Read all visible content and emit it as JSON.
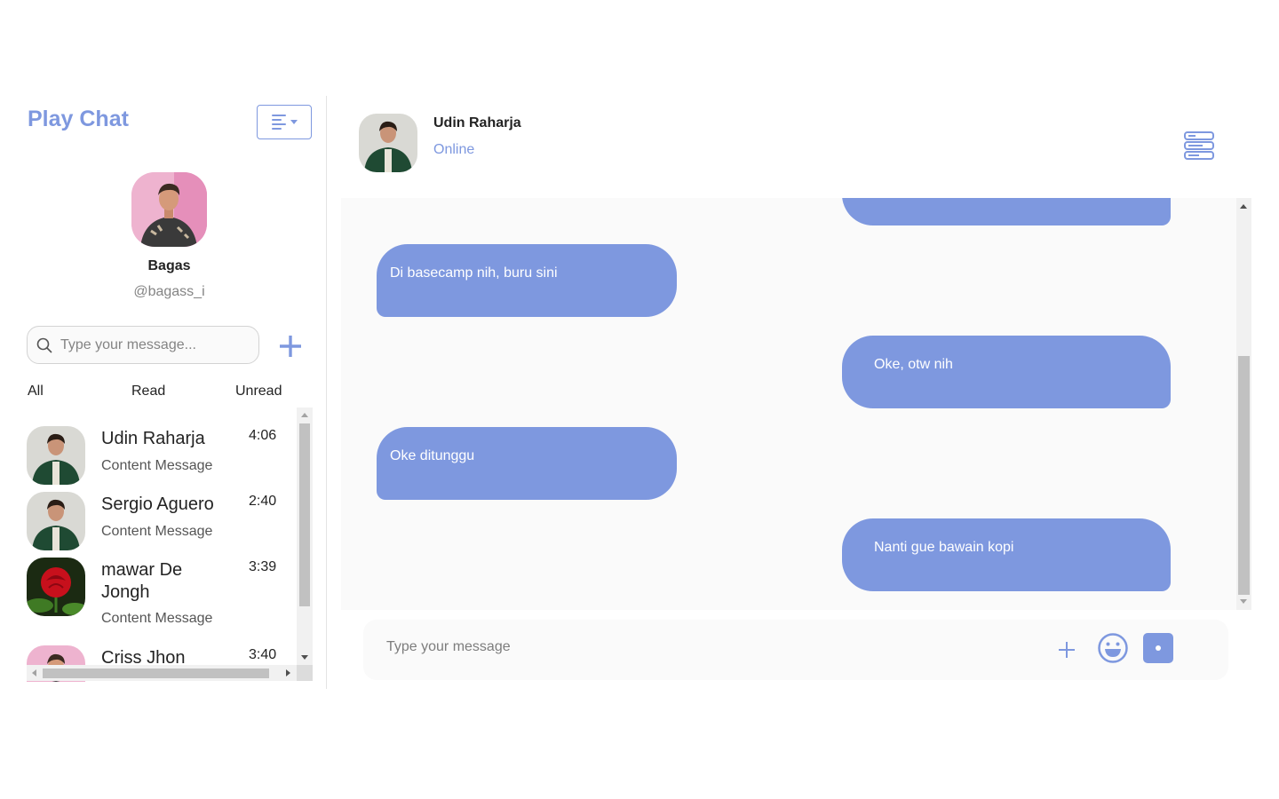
{
  "app": {
    "title": "Play Chat"
  },
  "colors": {
    "accent": "#7e98df",
    "bubble": "#7e98df",
    "panel_bg": "#fafafa"
  },
  "profile": {
    "name": "Bagas",
    "handle": "@bagass_i"
  },
  "search": {
    "placeholder": "Type your message..."
  },
  "filters": {
    "all": "All",
    "read": "Read",
    "unread": "Unread"
  },
  "chats": [
    {
      "name": "Udin Raharja",
      "time": "4:06",
      "message": "Content Message",
      "avatar": "person-green-jacket"
    },
    {
      "name": "Sergio Aguero",
      "time": "2:40",
      "message": "Content Message",
      "avatar": "person-green-jacket"
    },
    {
      "name": "mawar De Jongh",
      "time": "3:39",
      "message": "Content Message",
      "avatar": "red-rose"
    },
    {
      "name": "Criss Jhon",
      "time": "3:40",
      "message": "",
      "avatar": "person-pink-background"
    }
  ],
  "conversation": {
    "contact_name": "Udin Raharja",
    "status": "Online",
    "messages": [
      {
        "direction": "out",
        "text": ""
      },
      {
        "direction": "in",
        "text": "Di basecamp nih, buru sini"
      },
      {
        "direction": "out",
        "text": "Oke, otw nih"
      },
      {
        "direction": "in",
        "text": "Oke ditunggu"
      },
      {
        "direction": "out",
        "text": "Nanti gue bawain kopi"
      }
    ]
  },
  "composer": {
    "placeholder": "Type your message"
  },
  "icons": {
    "menu": "menu-lines-icon",
    "add_chat": "plus-icon",
    "search": "search-icon",
    "header_menu": "stacked-menu-icon",
    "attach": "plus-icon",
    "emoji": "emoji-icon",
    "send": "send-icon"
  }
}
